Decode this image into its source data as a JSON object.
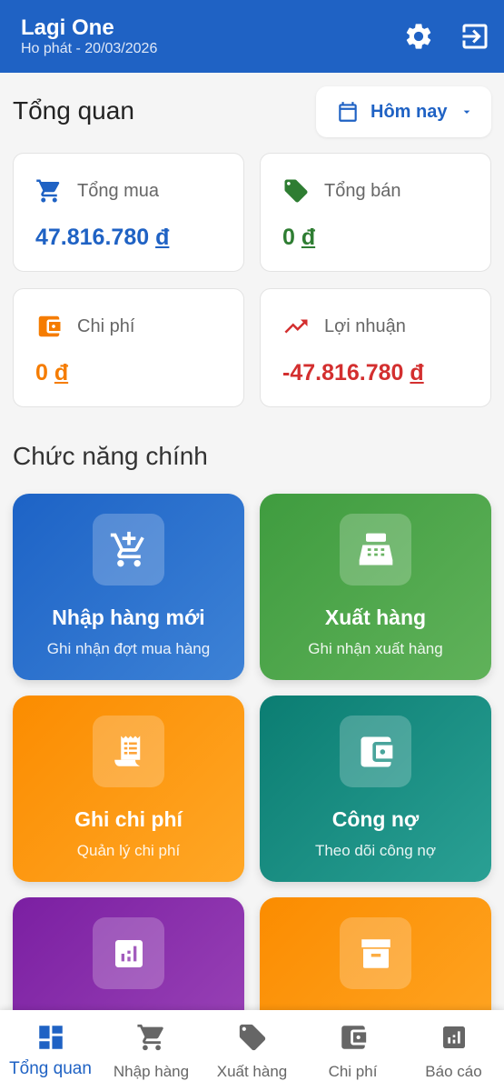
{
  "app": {
    "title": "Lagi One",
    "subtitle": "Ho phát - 20/03/2026"
  },
  "overview": {
    "heading": "Tổng quan",
    "date_filter": "Hôm nay"
  },
  "stats": [
    {
      "label": "Tổng mua",
      "amount": "47.816.780",
      "currency": "đ",
      "color": "#1f62c4",
      "icon": "cart-icon"
    },
    {
      "label": "Tổng bán",
      "amount": "0",
      "currency": "đ",
      "color": "#2e7d32",
      "icon": "tag-icon"
    },
    {
      "label": "Chi phí",
      "amount": "0",
      "currency": "đ",
      "color": "#f57c00",
      "icon": "wallet-icon"
    },
    {
      "label": "Lợi nhuận",
      "amount": "-47.816.780",
      "currency": "đ",
      "color": "#d32f2f",
      "icon": "trending-up-icon"
    }
  ],
  "main_section": {
    "heading": "Chức năng chính"
  },
  "tiles": [
    {
      "title": "Nhập hàng mới",
      "subtitle": "Ghi nhận đợt mua hàng",
      "icon": "add-cart-icon"
    },
    {
      "title": "Xuất hàng",
      "subtitle": "Ghi nhận xuất hàng",
      "icon": "cash-register-icon"
    },
    {
      "title": "Ghi chi phí",
      "subtitle": "Quản lý chi phí",
      "icon": "receipt-icon"
    },
    {
      "title": "Công nợ",
      "subtitle": "Theo dõi công nợ",
      "icon": "wallet-icon"
    },
    {
      "title": "",
      "subtitle": "",
      "icon": "chart-icon"
    },
    {
      "title": "",
      "subtitle": "",
      "icon": "archive-icon"
    }
  ],
  "bottom_nav": [
    {
      "label": "Tổng quan",
      "icon": "dashboard-icon",
      "active": true
    },
    {
      "label": "Nhập hàng",
      "icon": "cart-icon",
      "active": false
    },
    {
      "label": "Xuất hàng",
      "icon": "tag-icon",
      "active": false
    },
    {
      "label": "Chi phí",
      "icon": "wallet-icon",
      "active": false
    },
    {
      "label": "Báo cáo",
      "icon": "chart-icon",
      "active": false
    }
  ],
  "colors": {
    "primary": "#1f62c4",
    "nav_inactive": "#666666"
  }
}
